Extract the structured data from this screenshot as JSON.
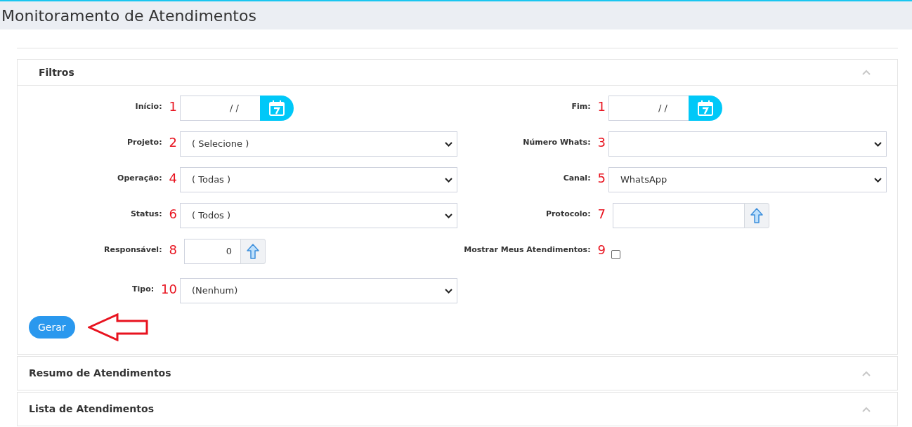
{
  "page_title": "Monitoramento de Atendimentos",
  "sections": [
    {
      "title": "Filtros",
      "expanded": true
    },
    {
      "title": "Resumo de Atendimentos",
      "expanded": false
    },
    {
      "title": "Lista de Atendimentos",
      "expanded": false
    }
  ],
  "filters": [
    [
      {
        "kind": "date",
        "label": "Início:",
        "marker": "1",
        "value": "/ /"
      },
      {
        "kind": "date",
        "label": "Fim:",
        "marker": "1",
        "value": "/ /"
      }
    ],
    [
      {
        "kind": "select",
        "label": "Projeto:",
        "marker": "2",
        "value": "( Selecione )"
      },
      {
        "kind": "select",
        "label": "Número Whats:",
        "marker": "3"
      }
    ],
    [
      {
        "kind": "select",
        "label": "Operação:",
        "marker": "4",
        "value": "( Todas )"
      },
      {
        "kind": "select",
        "label": "Canal:",
        "marker": "5",
        "value": "WhatsApp"
      }
    ],
    [
      {
        "kind": "select",
        "label": "Status:",
        "marker": "6",
        "value": "( Todos )"
      },
      {
        "kind": "lookup",
        "label": "Protocolo:",
        "marker": "7"
      }
    ],
    [
      {
        "kind": "lookup",
        "label": "Responsável:",
        "marker": "8",
        "value": "0"
      },
      {
        "kind": "checkbox",
        "label": "Mostrar Meus Atendimentos:",
        "marker": "9",
        "checked": false
      }
    ],
    [
      {
        "kind": "select",
        "label": "Tipo:",
        "marker": "10",
        "value": "(Nenhum)"
      }
    ]
  ],
  "generate_button": "Gerar"
}
